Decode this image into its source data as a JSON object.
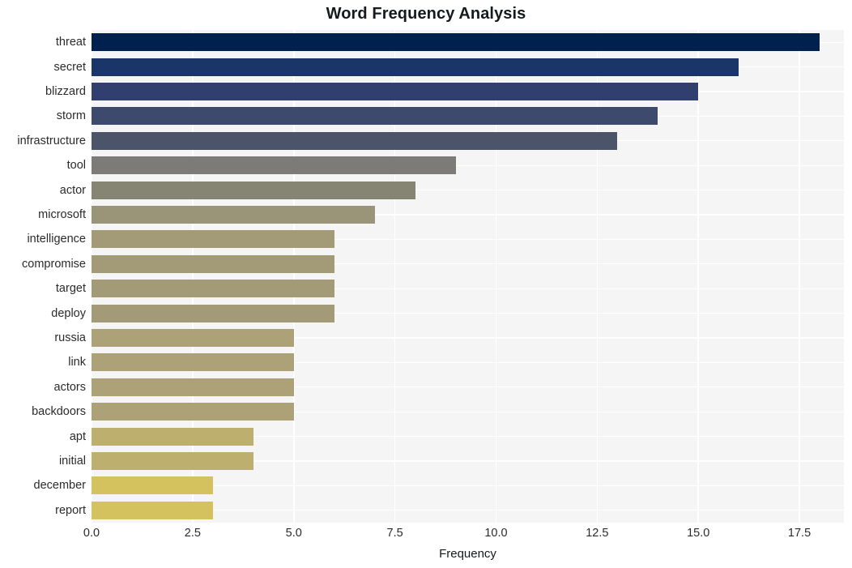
{
  "chart_data": {
    "type": "bar",
    "orientation": "horizontal",
    "title": "Word Frequency Analysis",
    "xlabel": "Frequency",
    "ylabel": "",
    "categories": [
      "threat",
      "secret",
      "blizzard",
      "storm",
      "infrastructure",
      "tool",
      "actor",
      "microsoft",
      "intelligence",
      "compromise",
      "target",
      "deploy",
      "russia",
      "link",
      "actors",
      "backdoors",
      "apt",
      "initial",
      "december",
      "report"
    ],
    "values": [
      18,
      16,
      15,
      14,
      13,
      9,
      8,
      7,
      6,
      6,
      6,
      6,
      5,
      5,
      5,
      5,
      4,
      4,
      3,
      3
    ],
    "bar_colors": [
      "#00214d",
      "#1a3568",
      "#313f6e",
      "#3e4a6d",
      "#4b5468",
      "#7c7b78",
      "#868472",
      "#9a9478",
      "#a39b78",
      "#a39b78",
      "#a39b78",
      "#a39b78",
      "#aca177",
      "#aca177",
      "#aca177",
      "#aca177",
      "#bdaf6d",
      "#bdaf6d",
      "#d4c25e",
      "#d4c25e"
    ],
    "xlim": [
      0,
      18.6
    ],
    "xticks": [
      0.0,
      2.5,
      5.0,
      7.5,
      10.0,
      12.5,
      15.0,
      17.5
    ],
    "xtick_labels": [
      "0.0",
      "2.5",
      "5.0",
      "7.5",
      "10.0",
      "12.5",
      "15.0",
      "17.5"
    ],
    "grid": "whitegrid",
    "legend": "none",
    "plot_background": "#f5f5f6",
    "figure_background": "#ffffff",
    "title_color": "#16191d",
    "tick_color": "#2b2b2b"
  }
}
